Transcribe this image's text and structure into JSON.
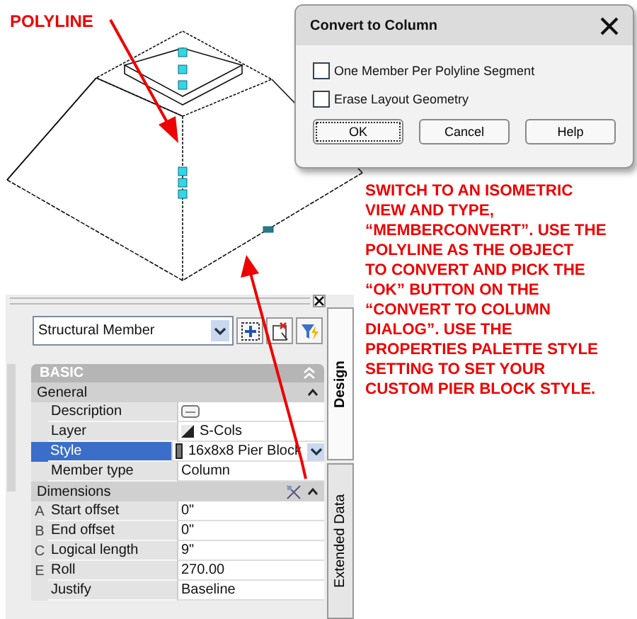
{
  "callout": "POLYLINE",
  "dialog": {
    "title": "Convert to Column",
    "options": [
      {
        "label": "One Member Per Polyline Segment",
        "checked": false
      },
      {
        "label": "Erase Layout Geometry",
        "checked": false
      }
    ],
    "buttons": [
      {
        "label": "OK",
        "focused": true
      },
      {
        "label": "Cancel",
        "focused": false
      },
      {
        "label": "Help",
        "focused": false
      }
    ]
  },
  "instruction": {
    "lines": [
      "SWITCH TO AN ISOMETRIC",
      "VIEW AND TYPE,",
      "“MEMBERCONVERT”.  USE THE",
      "POLYLINE AS THE OBJECT",
      "TO CONVERT AND PICK THE",
      "“OK” BUTTON ON THE",
      "“CONVERT TO COLUMN",
      "DIALOG”.  USE THE",
      "PROPERTIES PALETTE STYLE",
      "SETTING TO SET YOUR",
      "CUSTOM PIER BLOCK STYLE."
    ]
  },
  "palette": {
    "selector": "Structural Member",
    "side_tabs": [
      {
        "label": "Design",
        "selected": true
      },
      {
        "label": "Extended Data",
        "selected": false
      }
    ],
    "section": "BASIC",
    "groups": [
      {
        "title": "General",
        "expanded": true,
        "rows": [
          {
            "name": "Description",
            "kind": "button",
            "selected": false
          },
          {
            "name": "Layer",
            "kind": "layer",
            "value": "S-Cols",
            "selected": false
          },
          {
            "name": "Style",
            "kind": "dropdown",
            "value": "16x8x8 Pier Block",
            "selected": true
          },
          {
            "name": "Member type",
            "kind": "text",
            "value": "Column",
            "selected": false
          }
        ]
      },
      {
        "title": "Dimensions",
        "expanded": true,
        "rows": [
          {
            "letter": "A",
            "name": "Start offset",
            "kind": "text",
            "value": "0\"",
            "selected": false
          },
          {
            "letter": "B",
            "name": "End offset",
            "kind": "text",
            "value": "0\"",
            "selected": false
          },
          {
            "letter": "C",
            "name": "Logical length",
            "kind": "text",
            "value": "9\"",
            "selected": false
          },
          {
            "letter": "E",
            "name": "Roll",
            "kind": "text",
            "value": "270.00",
            "selected": false
          },
          {
            "name": "Justify",
            "kind": "text",
            "value": "Baseline",
            "selected": false
          }
        ]
      }
    ]
  }
}
